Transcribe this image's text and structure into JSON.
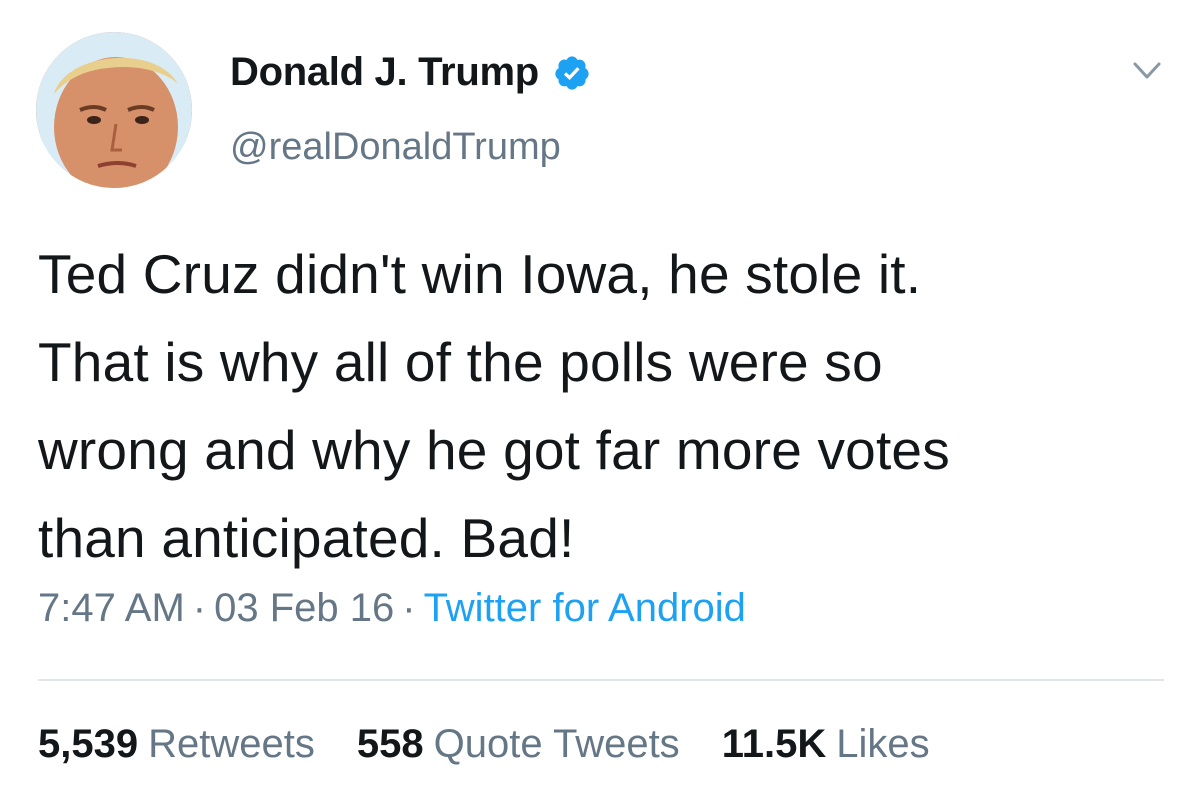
{
  "author": {
    "display_name": "Donald J. Trump",
    "handle": "@realDonaldTrump",
    "verified": true,
    "avatar_icon": "profile-photo"
  },
  "tweet": {
    "lines": [
      "Ted Cruz didn't win Iowa, he stole it.",
      "That is why all of the polls were so",
      "wrong and why he got far more votes",
      "than anticipated. Bad!"
    ]
  },
  "meta": {
    "time": "7:47 AM",
    "separator": "·",
    "date": "03 Feb 16",
    "source": "Twitter for Android"
  },
  "stats": {
    "retweets_count": "5,539",
    "retweets_label": "Retweets",
    "quotes_count": "558",
    "quotes_label": "Quote Tweets",
    "likes_count": "11.5K",
    "likes_label": "Likes"
  },
  "colors": {
    "text": "#14171a",
    "secondary": "#657786",
    "accent": "#1da1f2",
    "divider": "#dfe5ea"
  }
}
